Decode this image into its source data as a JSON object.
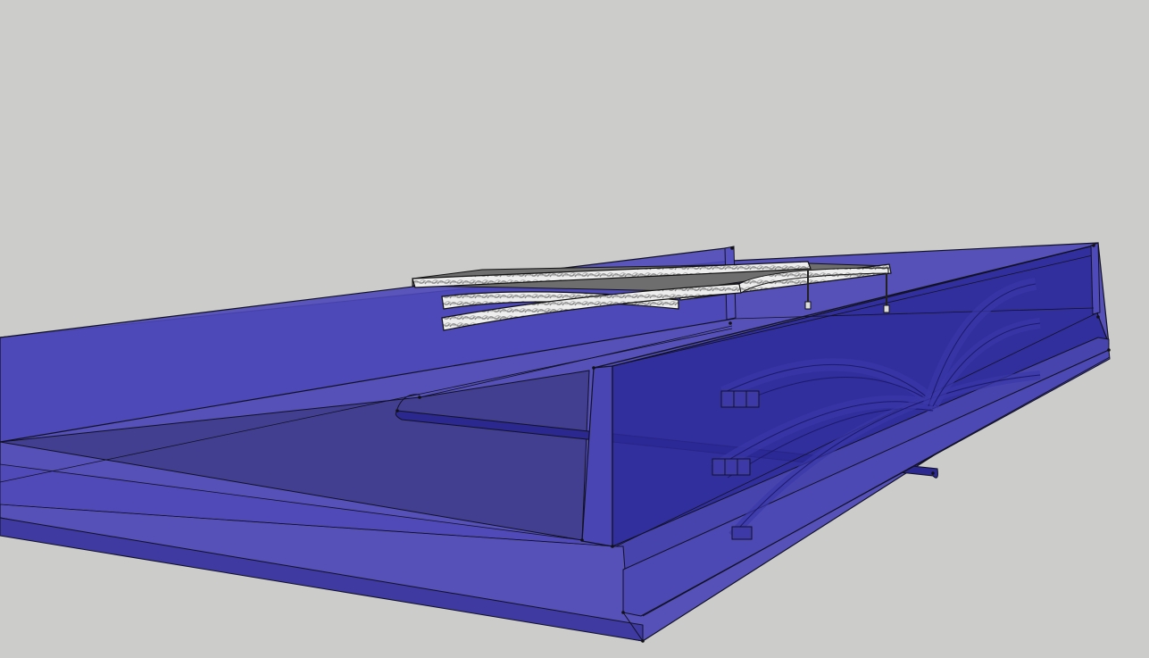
{
  "viewport": {
    "background": "#cccccb",
    "style": "3D modeling viewport, translucent blue model with bridge structure"
  },
  "colors": {
    "model_fill": "#4b47b8",
    "model_dark": "#2f2b8e",
    "model_light": "#5a56c4",
    "edge": "#111122",
    "bridge_deck": "#e8e8e8",
    "bridge_texture": "#9a9a9a"
  }
}
